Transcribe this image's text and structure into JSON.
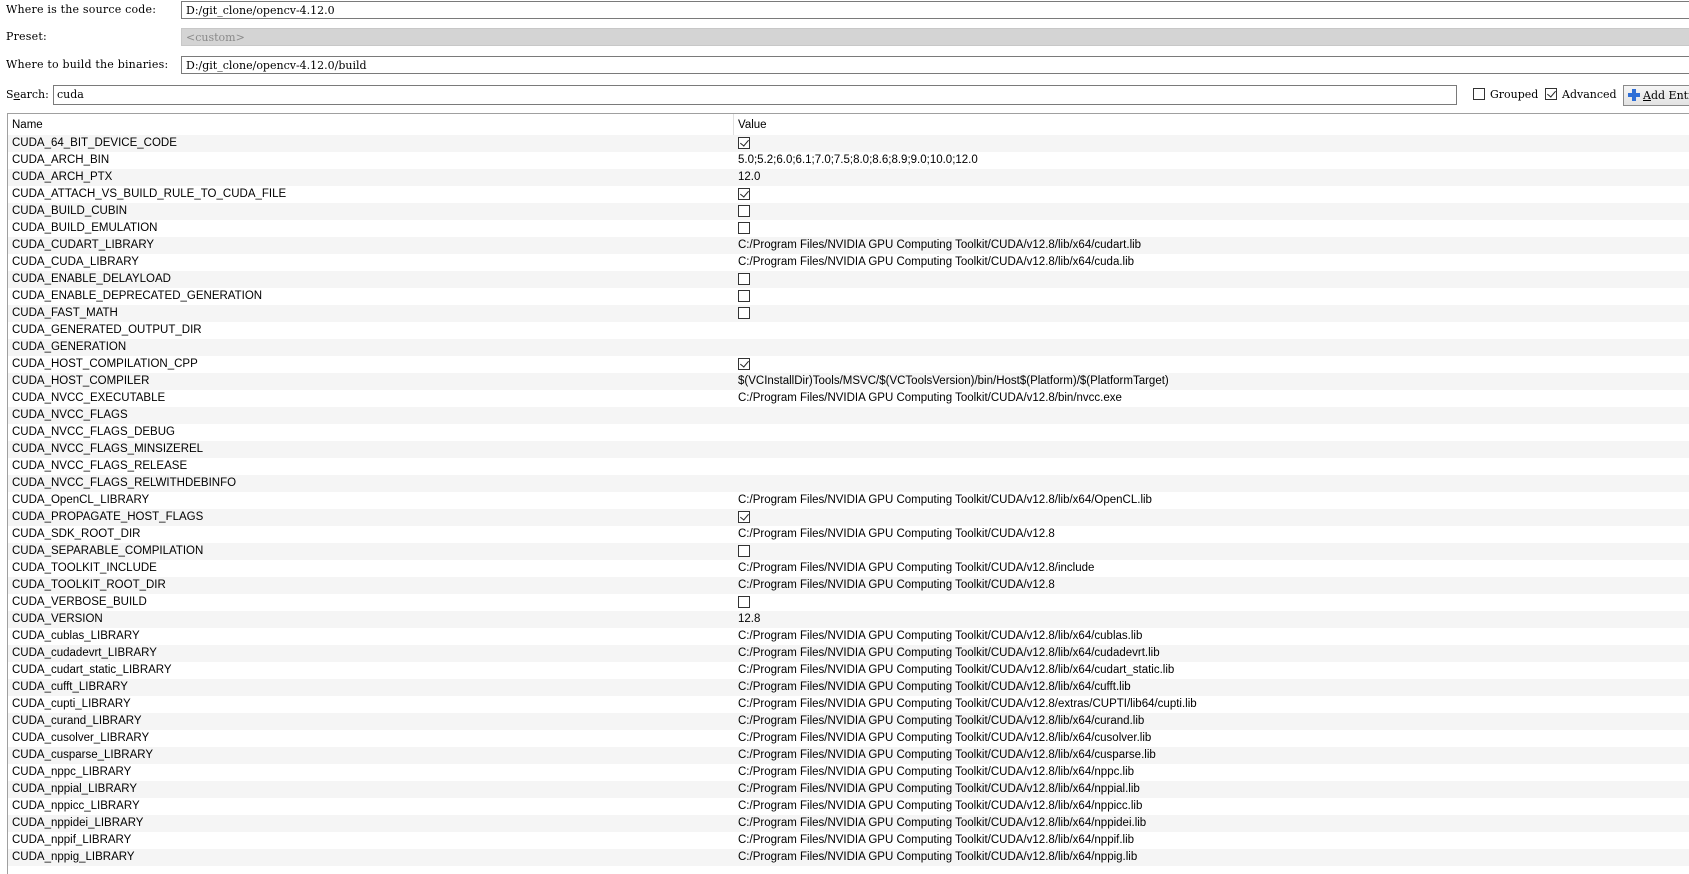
{
  "source": {
    "label": "Where is the source code:",
    "value": "D:/git_clone/opencv-4.12.0"
  },
  "preset": {
    "label": "Preset:",
    "value": "<custom>"
  },
  "binaries": {
    "label": "Where to build the binaries:",
    "value": "D:/git_clone/opencv-4.12.0/build"
  },
  "search": {
    "label_pre": "S",
    "label_u": "e",
    "label_post": "arch:",
    "value": "cuda",
    "grouped_label": "Grouped",
    "grouped_checked": false,
    "advanced_label": "Advanced",
    "advanced_checked": true,
    "add_entry_u": "A",
    "add_entry_rest": "dd Entry"
  },
  "table": {
    "header_name": "Name",
    "header_value": "Value",
    "rows": [
      {
        "name": "CUDA_64_BIT_DEVICE_CODE",
        "type": "bool",
        "checked": true
      },
      {
        "name": "CUDA_ARCH_BIN",
        "type": "text",
        "value": "5.0;5.2;6.0;6.1;7.0;7.5;8.0;8.6;8.9;9.0;10.0;12.0"
      },
      {
        "name": "CUDA_ARCH_PTX",
        "type": "text",
        "value": "12.0"
      },
      {
        "name": "CUDA_ATTACH_VS_BUILD_RULE_TO_CUDA_FILE",
        "type": "bool",
        "checked": true
      },
      {
        "name": "CUDA_BUILD_CUBIN",
        "type": "bool",
        "checked": false
      },
      {
        "name": "CUDA_BUILD_EMULATION",
        "type": "bool",
        "checked": false
      },
      {
        "name": "CUDA_CUDART_LIBRARY",
        "type": "text",
        "value": "C:/Program Files/NVIDIA GPU Computing Toolkit/CUDA/v12.8/lib/x64/cudart.lib"
      },
      {
        "name": "CUDA_CUDA_LIBRARY",
        "type": "text",
        "value": "C:/Program Files/NVIDIA GPU Computing Toolkit/CUDA/v12.8/lib/x64/cuda.lib"
      },
      {
        "name": "CUDA_ENABLE_DELAYLOAD",
        "type": "bool",
        "checked": false
      },
      {
        "name": "CUDA_ENABLE_DEPRECATED_GENERATION",
        "type": "bool",
        "checked": false
      },
      {
        "name": "CUDA_FAST_MATH",
        "type": "bool",
        "checked": false
      },
      {
        "name": "CUDA_GENERATED_OUTPUT_DIR",
        "type": "text",
        "value": ""
      },
      {
        "name": "CUDA_GENERATION",
        "type": "text",
        "value": ""
      },
      {
        "name": "CUDA_HOST_COMPILATION_CPP",
        "type": "bool",
        "checked": true
      },
      {
        "name": "CUDA_HOST_COMPILER",
        "type": "text",
        "value": "$(VCInstallDir)Tools/MSVC/$(VCToolsVersion)/bin/Host$(Platform)/$(PlatformTarget)"
      },
      {
        "name": "CUDA_NVCC_EXECUTABLE",
        "type": "text",
        "value": "C:/Program Files/NVIDIA GPU Computing Toolkit/CUDA/v12.8/bin/nvcc.exe"
      },
      {
        "name": "CUDA_NVCC_FLAGS",
        "type": "text",
        "value": ""
      },
      {
        "name": "CUDA_NVCC_FLAGS_DEBUG",
        "type": "text",
        "value": ""
      },
      {
        "name": "CUDA_NVCC_FLAGS_MINSIZEREL",
        "type": "text",
        "value": ""
      },
      {
        "name": "CUDA_NVCC_FLAGS_RELEASE",
        "type": "text",
        "value": ""
      },
      {
        "name": "CUDA_NVCC_FLAGS_RELWITHDEBINFO",
        "type": "text",
        "value": ""
      },
      {
        "name": "CUDA_OpenCL_LIBRARY",
        "type": "text",
        "value": "C:/Program Files/NVIDIA GPU Computing Toolkit/CUDA/v12.8/lib/x64/OpenCL.lib"
      },
      {
        "name": "CUDA_PROPAGATE_HOST_FLAGS",
        "type": "bool",
        "checked": true
      },
      {
        "name": "CUDA_SDK_ROOT_DIR",
        "type": "text",
        "value": "C:/Program Files/NVIDIA GPU Computing Toolkit/CUDA/v12.8"
      },
      {
        "name": "CUDA_SEPARABLE_COMPILATION",
        "type": "bool",
        "checked": false
      },
      {
        "name": "CUDA_TOOLKIT_INCLUDE",
        "type": "text",
        "value": "C:/Program Files/NVIDIA GPU Computing Toolkit/CUDA/v12.8/include"
      },
      {
        "name": "CUDA_TOOLKIT_ROOT_DIR",
        "type": "text",
        "value": "C:/Program Files/NVIDIA GPU Computing Toolkit/CUDA/v12.8"
      },
      {
        "name": "CUDA_VERBOSE_BUILD",
        "type": "bool",
        "checked": false
      },
      {
        "name": "CUDA_VERSION",
        "type": "text",
        "value": "12.8"
      },
      {
        "name": "CUDA_cublas_LIBRARY",
        "type": "text",
        "value": "C:/Program Files/NVIDIA GPU Computing Toolkit/CUDA/v12.8/lib/x64/cublas.lib"
      },
      {
        "name": "CUDA_cudadevrt_LIBRARY",
        "type": "text",
        "value": "C:/Program Files/NVIDIA GPU Computing Toolkit/CUDA/v12.8/lib/x64/cudadevrt.lib"
      },
      {
        "name": "CUDA_cudart_static_LIBRARY",
        "type": "text",
        "value": "C:/Program Files/NVIDIA GPU Computing Toolkit/CUDA/v12.8/lib/x64/cudart_static.lib"
      },
      {
        "name": "CUDA_cufft_LIBRARY",
        "type": "text",
        "value": "C:/Program Files/NVIDIA GPU Computing Toolkit/CUDA/v12.8/lib/x64/cufft.lib"
      },
      {
        "name": "CUDA_cupti_LIBRARY",
        "type": "text",
        "value": "C:/Program Files/NVIDIA GPU Computing Toolkit/CUDA/v12.8/extras/CUPTI/lib64/cupti.lib"
      },
      {
        "name": "CUDA_curand_LIBRARY",
        "type": "text",
        "value": "C:/Program Files/NVIDIA GPU Computing Toolkit/CUDA/v12.8/lib/x64/curand.lib"
      },
      {
        "name": "CUDA_cusolver_LIBRARY",
        "type": "text",
        "value": "C:/Program Files/NVIDIA GPU Computing Toolkit/CUDA/v12.8/lib/x64/cusolver.lib"
      },
      {
        "name": "CUDA_cusparse_LIBRARY",
        "type": "text",
        "value": "C:/Program Files/NVIDIA GPU Computing Toolkit/CUDA/v12.8/lib/x64/cusparse.lib"
      },
      {
        "name": "CUDA_nppc_LIBRARY",
        "type": "text",
        "value": "C:/Program Files/NVIDIA GPU Computing Toolkit/CUDA/v12.8/lib/x64/nppc.lib"
      },
      {
        "name": "CUDA_nppial_LIBRARY",
        "type": "text",
        "value": "C:/Program Files/NVIDIA GPU Computing Toolkit/CUDA/v12.8/lib/x64/nppial.lib"
      },
      {
        "name": "CUDA_nppicc_LIBRARY",
        "type": "text",
        "value": "C:/Program Files/NVIDIA GPU Computing Toolkit/CUDA/v12.8/lib/x64/nppicc.lib"
      },
      {
        "name": "CUDA_nppidei_LIBRARY",
        "type": "text",
        "value": "C:/Program Files/NVIDIA GPU Computing Toolkit/CUDA/v12.8/lib/x64/nppidei.lib"
      },
      {
        "name": "CUDA_nppif_LIBRARY",
        "type": "text",
        "value": "C:/Program Files/NVIDIA GPU Computing Toolkit/CUDA/v12.8/lib/x64/nppif.lib"
      },
      {
        "name": "CUDA_nppig_LIBRARY",
        "type": "text",
        "value": "C:/Program Files/NVIDIA GPU Computing Toolkit/CUDA/v12.8/lib/x64/nppig.lib"
      }
    ]
  }
}
